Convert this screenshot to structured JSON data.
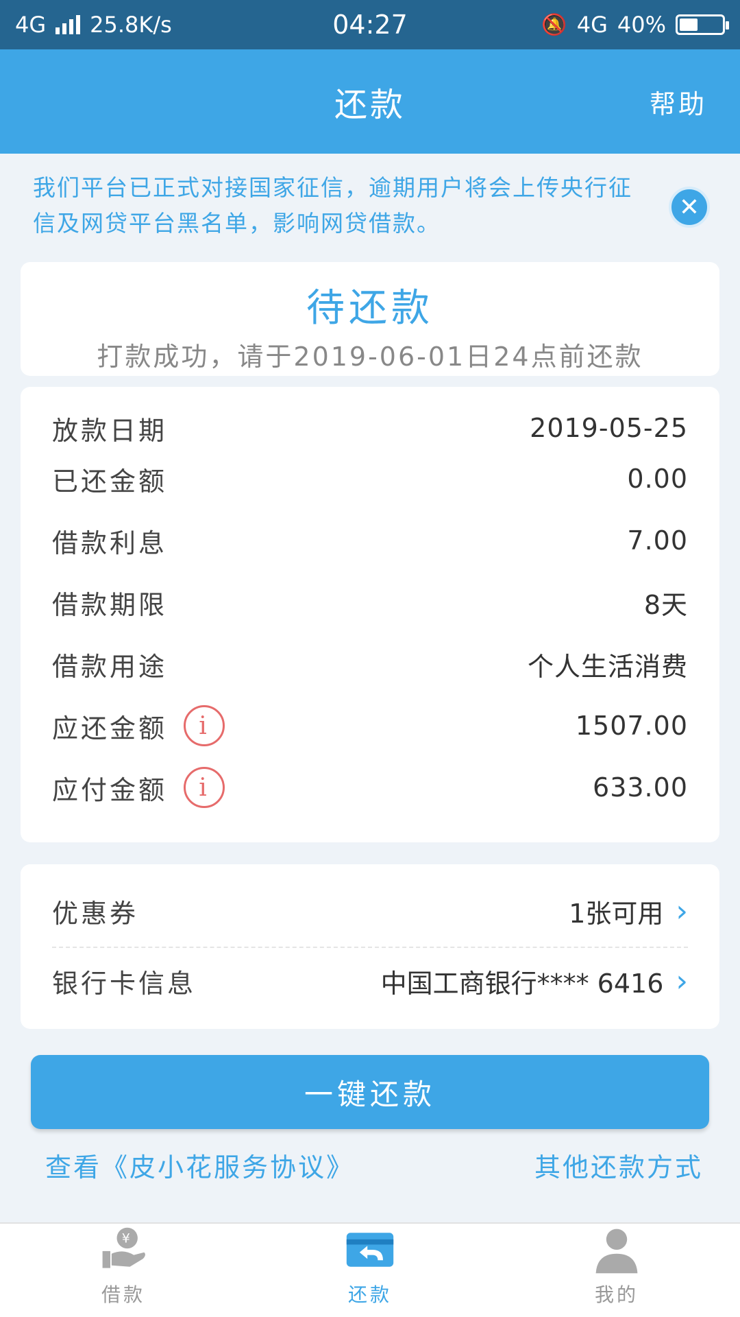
{
  "status_bar": {
    "network": "4G",
    "speed": "25.8K/s",
    "time": "04:27",
    "network_right": "4G",
    "battery": "40%",
    "battery_level": 0.4
  },
  "header": {
    "title": "还款",
    "help": "帮助"
  },
  "notice": {
    "text": "我们平台已正式对接国家征信，逾期用户将会上传央行征信及网贷平台黑名单，影响网贷借款。"
  },
  "status_card": {
    "title": "待还款",
    "subtitle": "打款成功，请于2019-06-01日24点前还款"
  },
  "details": [
    {
      "label": "放款日期",
      "value": "2019-05-25"
    },
    {
      "label": "已还金额",
      "value": "0.00"
    },
    {
      "label": "借款利息",
      "value": "7.00"
    },
    {
      "label": "借款期限",
      "value": "8天"
    },
    {
      "label": "借款用途",
      "value": "个人生活消费"
    },
    {
      "label": "应还金额",
      "value": "1507.00"
    },
    {
      "label": "应付金额",
      "value": "633.00"
    }
  ],
  "coupon": {
    "label": "优惠券",
    "value": "1张可用"
  },
  "bank": {
    "label": "银行卡信息",
    "value": "中国工商银行**** 6416"
  },
  "pay_button": "一键还款",
  "links": {
    "agreement": "查看《皮小花服务协议》",
    "other": "其他还款方式"
  },
  "tabs": [
    {
      "label": "借款",
      "active": false
    },
    {
      "label": "还款",
      "active": true
    },
    {
      "label": "我的",
      "active": false
    }
  ],
  "colors": {
    "accent": "#3ea6e6",
    "status_bar": "#256590",
    "warning": "#e66b6b"
  }
}
